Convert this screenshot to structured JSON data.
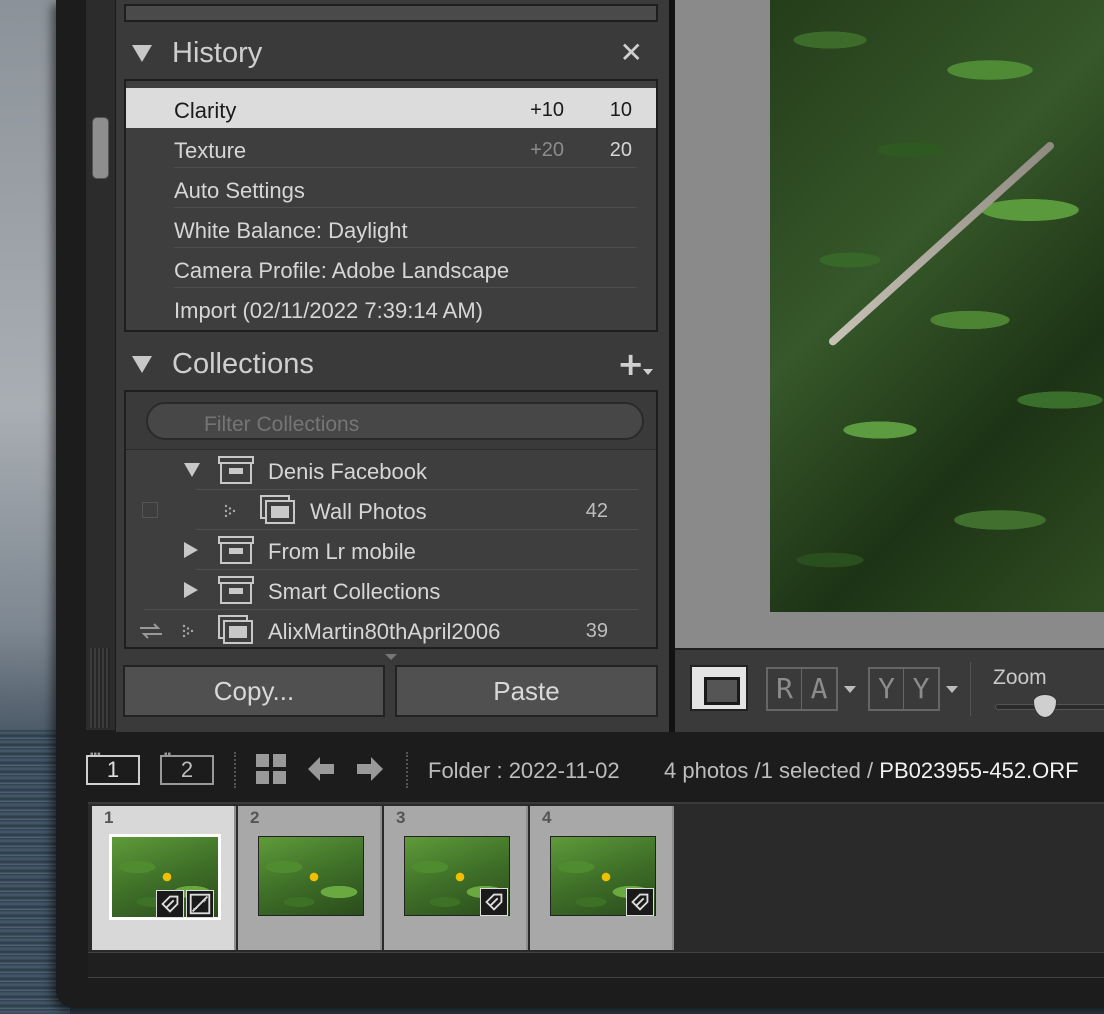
{
  "history": {
    "title": "History",
    "close_icon": "close-x-icon",
    "items": [
      {
        "label": "Clarity",
        "delta": "+10",
        "value": "10"
      },
      {
        "label": "Texture",
        "delta": "+20",
        "value": "20"
      },
      {
        "label": "Auto Settings",
        "delta": "",
        "value": ""
      },
      {
        "label": "White Balance: Daylight",
        "delta": "",
        "value": ""
      },
      {
        "label": "Camera Profile: Adobe Landscape",
        "delta": "",
        "value": ""
      },
      {
        "label": "Import (02/11/2022 7:39:14 AM)",
        "delta": "",
        "value": ""
      }
    ]
  },
  "collections": {
    "title": "Collections",
    "add_icon": "plus-icon",
    "filter_placeholder": "Filter Collections",
    "items": [
      {
        "name": "Denis Facebook",
        "count": ""
      },
      {
        "name": "Wall Photos",
        "count": "42"
      },
      {
        "name": "From Lr mobile",
        "count": ""
      },
      {
        "name": "Smart Collections",
        "count": ""
      },
      {
        "name": "AlixMartin80thApril2006",
        "count": "39"
      }
    ]
  },
  "buttons": {
    "copy": "Copy...",
    "paste": "Paste"
  },
  "toolbar": {
    "compare_ra": [
      "R",
      "A"
    ],
    "compare_yy": [
      "Y",
      "Y"
    ],
    "zoom_label": "Zoom"
  },
  "filmstrip": {
    "monitor_1": "1",
    "monitor_2": "2",
    "folder": "Folder : 2022-11-02",
    "count": "4 photos /1 selected /",
    "filename": "PB023955-452.ORF",
    "thumbs": [
      {
        "num": "1",
        "selected": true
      },
      {
        "num": "2",
        "selected": false
      },
      {
        "num": "3",
        "selected": false
      },
      {
        "num": "4",
        "selected": false
      }
    ]
  },
  "colors": {
    "panel": "#3a3a3a",
    "selected_row": "#dcdcdc",
    "text": "#d6d6d6"
  }
}
